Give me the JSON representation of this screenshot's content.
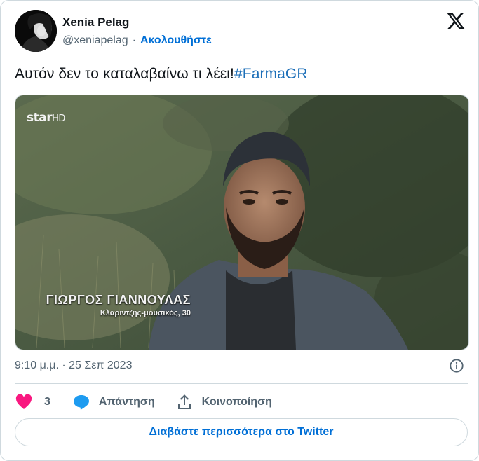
{
  "author": {
    "name": "Xenia Pelag",
    "handle": "@xeniapelag",
    "separator": "·",
    "follow_label": "Ακολουθήστε"
  },
  "tweet": {
    "text": "Αυτόν δεν το καταλαβαίνω τι λέει!",
    "hashtag": "#FarmaGR"
  },
  "media": {
    "channel_logo_star": "star",
    "channel_logo_hd": "HD",
    "lower_third_name": "ΓΙΩΡΓΟΣ ΓΙΑΝΝΟΥΛΑΣ",
    "lower_third_caption": "Κλαριντζής-μουσικός, 30"
  },
  "meta": {
    "timestamp": "9:10 μ.μ. · 25 Σεπ 2023"
  },
  "actions": {
    "likes_count": "3",
    "reply_label": "Απάντηση",
    "share_label": "Κοινοποίηση"
  },
  "read_more_label": "Διαβάστε περισσότερα στο Twitter",
  "colors": {
    "like": "#f91880",
    "reply": "#1d9bf0",
    "link": "#006fd6",
    "border": "#cfd9de",
    "secondary_text": "#536471"
  }
}
